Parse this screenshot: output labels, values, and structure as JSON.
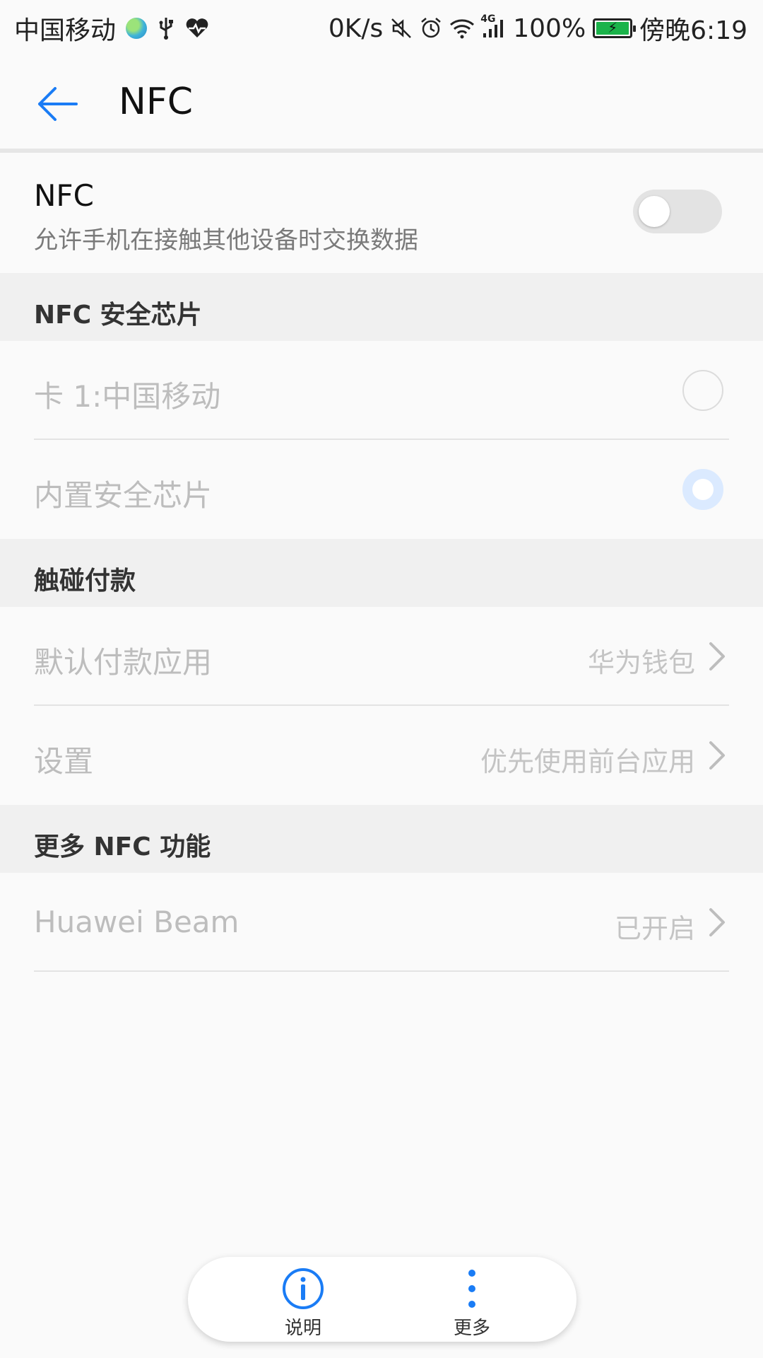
{
  "status_bar": {
    "carrier": "中国移动",
    "speed": "0K/s",
    "signal": "4G",
    "battery_percent": "100%",
    "battery_level": 1.0,
    "time": "傍晚6:19",
    "icons": [
      "globe-icon",
      "usb-icon",
      "heart-icon",
      "mute-icon",
      "alarm-icon",
      "wifi-icon",
      "signal-icon",
      "battery-icon"
    ]
  },
  "app_bar": {
    "title": "NFC"
  },
  "nfc_toggle": {
    "title": "NFC",
    "subtitle": "允许手机在接触其他设备时交换数据",
    "enabled": false
  },
  "sections": {
    "secure_chip": {
      "header": "NFC 安全芯片",
      "options": [
        {
          "label": "卡 1:中国移动",
          "selected": false
        },
        {
          "label": "内置安全芯片",
          "selected": true
        }
      ]
    },
    "tap_pay": {
      "header": "触碰付款",
      "rows": [
        {
          "label": "默认付款应用",
          "value": "华为钱包"
        },
        {
          "label": "设置",
          "value": "优先使用前台应用"
        }
      ]
    },
    "more_nfc": {
      "header": "更多 NFC 功能",
      "rows": [
        {
          "label": "Huawei Beam",
          "value": "已开启"
        }
      ]
    }
  },
  "bottom_bar": {
    "info_label": "说明",
    "more_label": "更多"
  },
  "colors": {
    "accent": "#1a7cf5",
    "disabled_text": "#bdbdbd"
  }
}
